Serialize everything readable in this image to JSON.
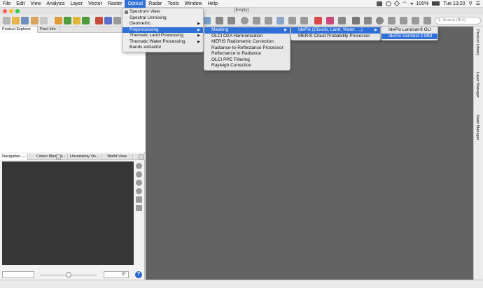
{
  "menubar": {
    "items": [
      "File",
      "Edit",
      "View",
      "Analysis",
      "Layer",
      "Vector",
      "Raster",
      "Optical",
      "Radar",
      "Tools",
      "Window",
      "Help"
    ],
    "active": "Optical",
    "battery": "100%",
    "clock": "Tue 13:20"
  },
  "window": {
    "title": "[Empty]"
  },
  "toolbar": {
    "search_placeholder": "Q- Search (⌘+I)"
  },
  "left_panel": {
    "top_tabs": [
      "Product Explorer",
      "Pixel Info"
    ],
    "nav_tabs": [
      "Navigation -...",
      "Colour Manipul...",
      "Uncertainty Vis...",
      "World View"
    ],
    "angle_value": "0°",
    "help_label": "?"
  },
  "right_panel": {
    "tabs": [
      "Product Library",
      "Layer Manager",
      "Mask Manager"
    ]
  },
  "menus": {
    "optical": [
      "Spectrum View",
      "Spectral Unmixing",
      "Geometric",
      "Preprocessing",
      "Thematic Land Processing",
      "Thematic Water Processing",
      "Bands extractor"
    ],
    "preprocessing": [
      "Masking",
      "OLCI O2A Harmonisation",
      "MERIS Radiometric Correction",
      "Radiance-to-Reflectance Processor",
      "Reflectance to Radiance",
      "OLCI PPE Filtering",
      "Rayleigh Correction"
    ],
    "masking": [
      "IdePix (Clouds, Land, Water, ...)",
      "MERIS Cloud Probability Processor"
    ],
    "idepix": [
      "IdePix Landsat-8 OLI",
      "IdePix Sentinel-2 MSI"
    ]
  },
  "colors": {
    "accent": "#2f6fd8",
    "main_bg": "#636363",
    "nav_bg": "#363636"
  }
}
